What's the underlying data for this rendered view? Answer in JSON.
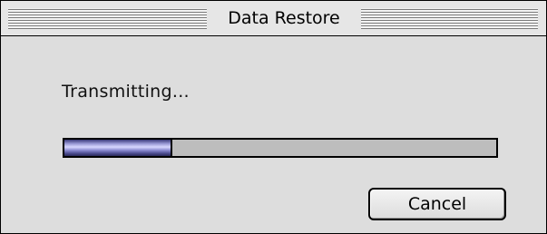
{
  "window": {
    "title": "Data Restore"
  },
  "status": {
    "label": "Transmitting..."
  },
  "progress": {
    "fraction": 0.25
  },
  "buttons": {
    "cancel_label": "Cancel"
  }
}
